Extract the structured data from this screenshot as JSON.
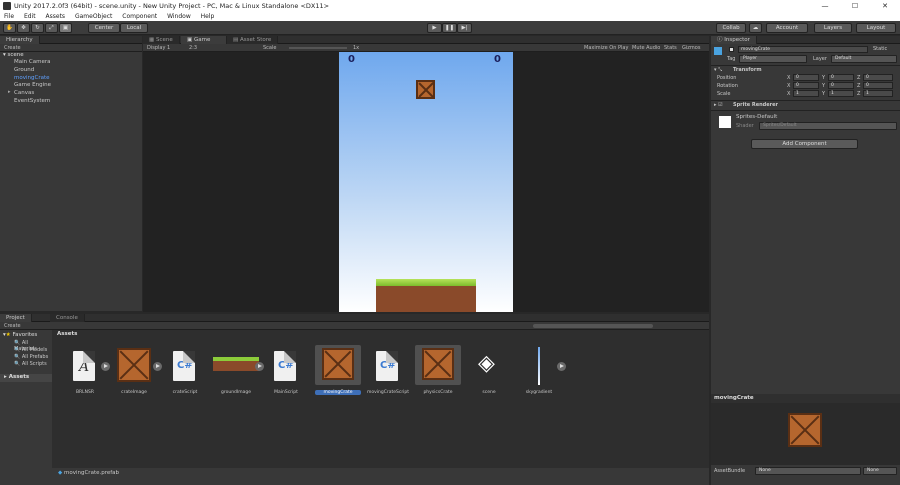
{
  "window": {
    "title": "Unity 2017.2.0f3 (64bit) - scene.unity - New Unity Project - PC, Mac & Linux Standalone <DX11>",
    "minimize": "—",
    "maximize": "☐",
    "close": "✕"
  },
  "menu": [
    "File",
    "Edit",
    "Assets",
    "GameObject",
    "Component",
    "Window",
    "Help"
  ],
  "toolbar": {
    "center": "Center",
    "local": "Local",
    "play": "▶",
    "pause": "❚❚",
    "step": "▶|",
    "collab": "Collab",
    "account": "Account",
    "layers": "Layers",
    "layout": "Layout"
  },
  "hierarchy": {
    "tab": "Hierarchy",
    "create": "Create",
    "scene": "scene",
    "items": [
      "Main Camera",
      "Ground",
      "movingCrate",
      "Game Engine",
      "Canvas",
      "EventSystem"
    ],
    "selected": "movingCrate"
  },
  "center_tabs": [
    "Scene",
    "Game",
    "Asset Store"
  ],
  "game_bar": {
    "display": "Display 1",
    "aspect": "2:3",
    "scale_label": "Scale",
    "scale_value": "1x",
    "maximize": "Maximize On Play",
    "mute": "Mute Audio",
    "stats": "Stats",
    "gizmos": "Gizmos"
  },
  "game_view": {
    "score_left": "0",
    "score_right": "0",
    "sky_top": "#6fa8ee",
    "sky_bottom": "#ffffff"
  },
  "project": {
    "tabs": [
      "Project",
      "Console"
    ],
    "create": "Create",
    "favorites": "Favorites",
    "fav_items": [
      "All Materials",
      "All Models",
      "All Prefabs",
      "All Scripts"
    ],
    "assets_root": "Assets",
    "assets_header": "Assets",
    "assets": [
      {
        "name": "BRLNSR",
        "icon": "font-icon"
      },
      {
        "name": "crateImage",
        "icon": "crate-icon"
      },
      {
        "name": "crateScript",
        "icon": "csharp-icon"
      },
      {
        "name": "groundImage",
        "icon": "ground-icon"
      },
      {
        "name": "MainScript",
        "icon": "csharp-icon"
      },
      {
        "name": "movingCrate",
        "icon": "crate-icon"
      },
      {
        "name": "movingCrateScript",
        "icon": "csharp-icon"
      },
      {
        "name": "physicsCrate",
        "icon": "crate-icon"
      },
      {
        "name": "scene",
        "icon": "unity-icon"
      },
      {
        "name": "skygradient",
        "icon": "gradient-icon"
      }
    ],
    "selected_asset": "movingCrate",
    "footer_file": "movingCrate.prefab"
  },
  "inspector": {
    "tab": "Inspector",
    "object_name": "movingCrate",
    "static": "Static",
    "tag_label": "Tag",
    "tag_value": "Player",
    "layer_label": "Layer",
    "layer_value": "Default",
    "transform": "Transform",
    "position_label": "Position",
    "rotation_label": "Rotation",
    "scale_label": "Scale",
    "position": [
      "0",
      "0",
      "0"
    ],
    "rotation": [
      "0",
      "0",
      "0"
    ],
    "scale": [
      "1",
      "1",
      "1"
    ],
    "axis": [
      "X",
      "Y",
      "Z"
    ],
    "sprite_renderer": "Sprite Renderer",
    "material": "Sprites-Default",
    "shader_label": "Shader",
    "shader_value": "Sprites/Default",
    "add_component": "Add Component"
  },
  "preview": {
    "title": "movingCrate",
    "asset_bundle_label": "AssetBundle",
    "bundle_value": "None",
    "variant_value": "None"
  }
}
